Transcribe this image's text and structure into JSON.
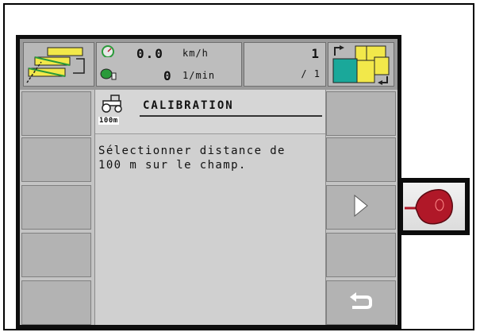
{
  "status": {
    "speed_value": "0.0",
    "speed_unit": "km/h",
    "rpm_value": "0",
    "rpm_unit": "1/min",
    "counter_value": "1",
    "counter_sub": "/ 1"
  },
  "panel": {
    "badge_text": "100m",
    "title": "CALIBRATION",
    "message": "Sélectionner distance de\n100 m sur le champ."
  },
  "icons": {
    "field_edge_icon": "field-edges-icon",
    "speedometer": "speedometer-icon",
    "rpm": "rpm-sensor-icon",
    "mode": "section-mode-icon",
    "tractor": "tractor-icon",
    "next": "next-arrow-icon",
    "back": "return-icon",
    "ext": "physical-button-icon"
  },
  "colors": {
    "accent_yellow": "#f2e84a",
    "accent_teal": "#1aa89a",
    "accent_green": "#2a9a3a",
    "ext_button_red": "#b01828"
  }
}
